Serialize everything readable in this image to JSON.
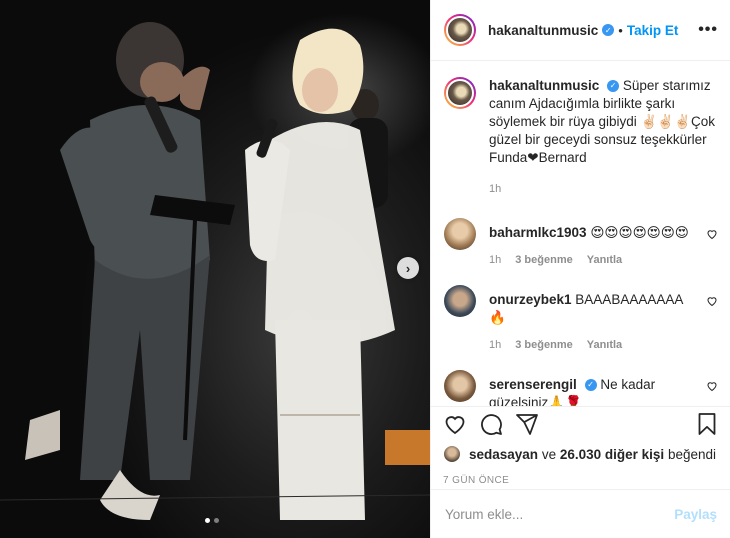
{
  "post": {
    "username": "hakanaltunmusic",
    "follow_label": "Takip Et",
    "more_label": "•••",
    "next_label": "›",
    "caption": {
      "username": "hakanaltunmusic",
      "text": "Süper starımız canım Ajdacığımla birlikte şarkı söylemek bir rüya gibiydi ✌🏻✌🏻✌🏻Çok güzel bir geceydi sonsuz teşekkürler Funda❤Bernard",
      "time": "1h"
    },
    "comments": [
      {
        "username": "baharmlkc1903",
        "text": "😍😍😍😍😍😍😍",
        "time": "1h",
        "likes": "3 beğenme",
        "reply": "Yanıtla",
        "verified": false
      },
      {
        "username": "onurzeybek1",
        "text": "BAAABAAAAAAA 🔥",
        "time": "1h",
        "likes": "3 beğenme",
        "reply": "Yanıtla",
        "verified": false
      },
      {
        "username": "serenserengil",
        "text": "Ne kadar güzelsiniz🙏🌹",
        "verified": true
      }
    ],
    "liked_by": {
      "user": "sedasayan",
      "connector": "ve",
      "count": "26.030 diğer kişi",
      "suffix": "beğendi"
    },
    "date": "7 GÜN ÖNCE",
    "add_comment_placeholder": "Yorum ekle...",
    "post_button": "Paylaş",
    "carousel": {
      "total": 2,
      "current": 1
    }
  },
  "colors": {
    "accent": "#0095f6",
    "verified": "#3897f0",
    "muted": "#8e8e8e",
    "post_disabled": "#b2dffc"
  },
  "icons": [
    "verified-icon",
    "more-icon",
    "heart-icon",
    "comment-icon",
    "share-icon",
    "save-icon",
    "next-arrow-icon"
  ]
}
